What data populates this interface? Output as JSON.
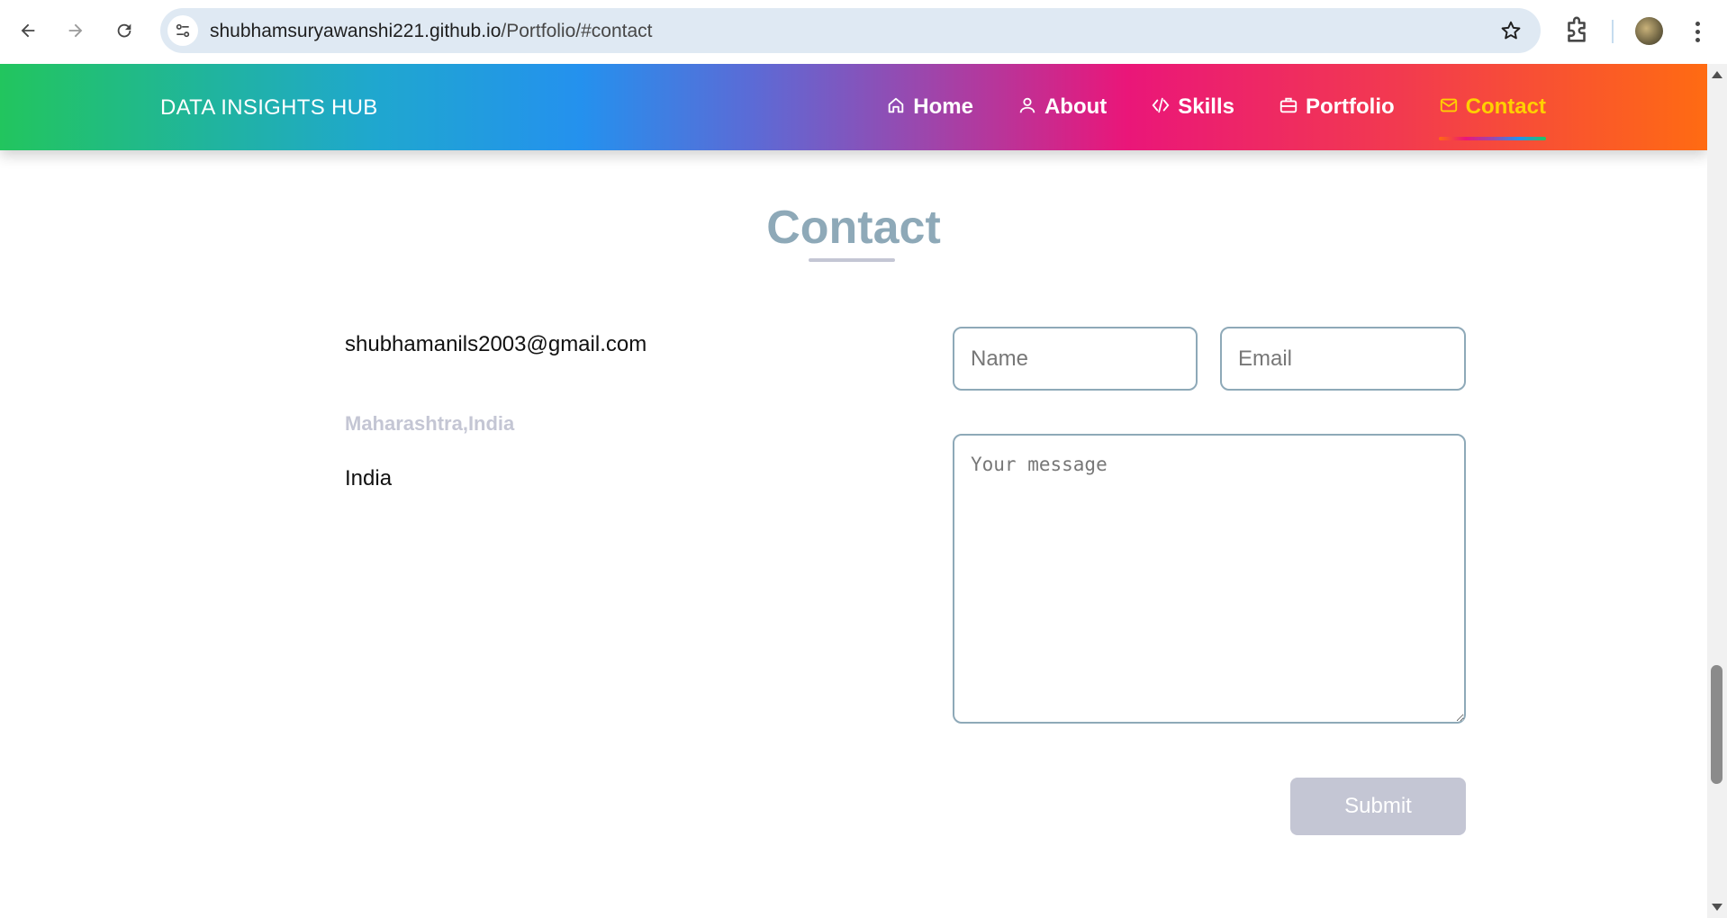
{
  "browser": {
    "url_host": "shubhamsuryawanshi221.github.io",
    "url_path": "/Portfolio/#contact",
    "icons": [
      "back-arrow-icon",
      "forward-arrow-icon",
      "reload-icon",
      "site-info-icon",
      "bookmark-star-icon",
      "extensions-puzzle-icon",
      "profile-avatar",
      "kebab-menu-icon"
    ]
  },
  "header": {
    "brand": "DATA INSIGHTS HUB",
    "nav": [
      {
        "label": "Home",
        "icon": "home-icon"
      },
      {
        "label": "About",
        "icon": "user-icon"
      },
      {
        "label": "Skills",
        "icon": "code-icon"
      },
      {
        "label": "Portfolio",
        "icon": "briefcase-icon"
      },
      {
        "label": "Contact",
        "icon": "mail-icon",
        "active": true
      }
    ],
    "active_color": "#ffd000"
  },
  "contact": {
    "title": "Contact",
    "email": "shubhamanils2003@gmail.com",
    "region": "Maharashtra,India",
    "country": "India",
    "form": {
      "name_placeholder": "Name",
      "email_placeholder": "Email",
      "message_placeholder": "Your message",
      "submit_label": "Submit"
    }
  },
  "colors": {
    "title": "#8ea9b8",
    "muted": "#c4c6d4",
    "field_border": "#8ea9b8"
  }
}
